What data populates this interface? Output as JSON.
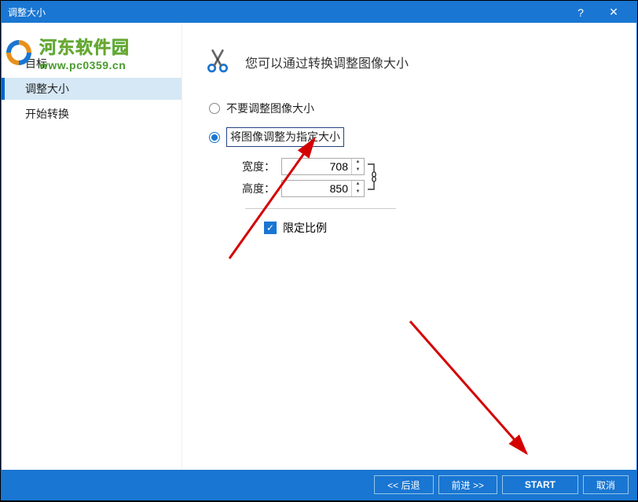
{
  "window": {
    "title": "调整大小"
  },
  "titlebar": {
    "help": "?",
    "close": "✕"
  },
  "sidebar": {
    "items": [
      {
        "label": "目标"
      },
      {
        "label": "调整大小"
      },
      {
        "label": "开始转换"
      }
    ]
  },
  "page": {
    "title": "您可以通过转换调整图像大小"
  },
  "form": {
    "radio_no_resize": "不要调整图像大小",
    "radio_resize": "将图像调整为指定大小",
    "width_label": "宽度：",
    "width_value": "708",
    "height_label": "高度：",
    "height_value": "850",
    "lock_ratio": "限定比例"
  },
  "footer": {
    "back": "<<  后退",
    "forward": "前进  >>",
    "start": "START",
    "cancel": "取消"
  },
  "watermark": {
    "line1": "河东软件园",
    "line2": "www.pc0359.cn"
  }
}
